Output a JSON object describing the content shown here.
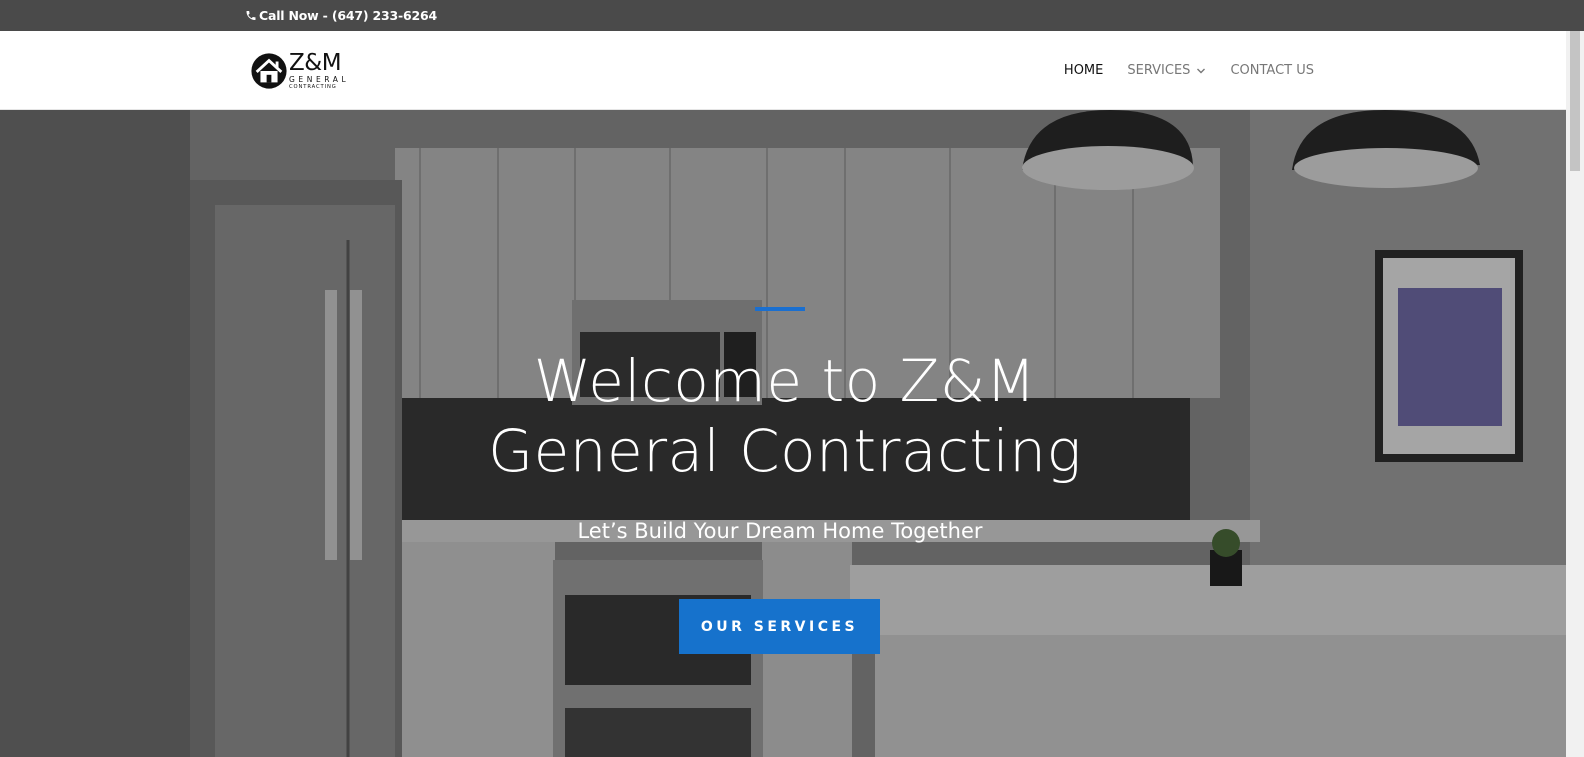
{
  "topbar": {
    "phone_text": "Call Now - (647) 233-6264",
    "background": "#4a4a4a"
  },
  "logo": {
    "main": "Z&M",
    "sub1": "GENERAL",
    "sub2": "CONTRACTING"
  },
  "nav": {
    "items": [
      {
        "label": "HOME",
        "active": true
      },
      {
        "label": "SERVICES",
        "has_dropdown": true
      },
      {
        "label": "CONTACT US"
      }
    ]
  },
  "hero": {
    "title_line1": "Welcome to Z&M",
    "title_line2": "General Contracting",
    "subtitle": "Let’s Build Your Dream Home Together",
    "button_label": "OUR SERVICES",
    "accent_color": "#1672cc"
  }
}
